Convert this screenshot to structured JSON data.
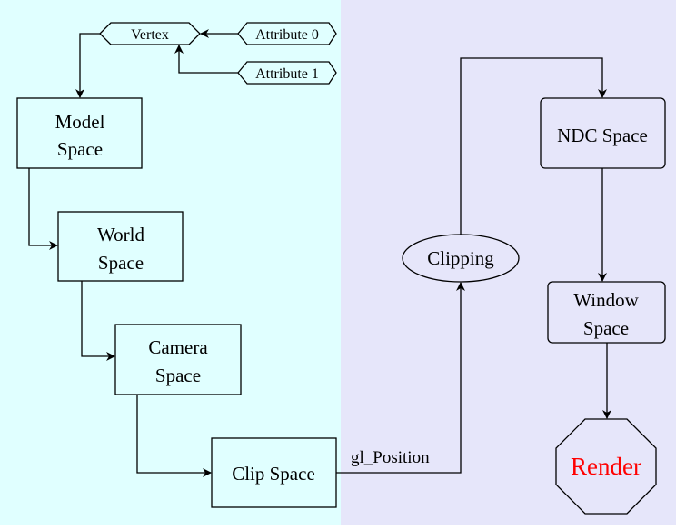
{
  "colors": {
    "left_bg": "#e0ffff",
    "right_bg": "#e6e6fa",
    "stroke": "#000000",
    "render_text": "#ff0000"
  },
  "nodes": {
    "vertex": "Vertex",
    "attribute0": "Attribute 0",
    "attribute1": "Attribute 1",
    "model_space": [
      "Model",
      "Space"
    ],
    "world_space": [
      "World",
      "Space"
    ],
    "camera_space": [
      "Camera",
      "Space"
    ],
    "clip_space": "Clip Space",
    "clipping": "Clipping",
    "ndc_space": "NDC Space",
    "window_space": [
      "Window",
      "Space"
    ],
    "render": "Render"
  },
  "edges": {
    "clip_to_clipping_label": "gl_Position"
  }
}
